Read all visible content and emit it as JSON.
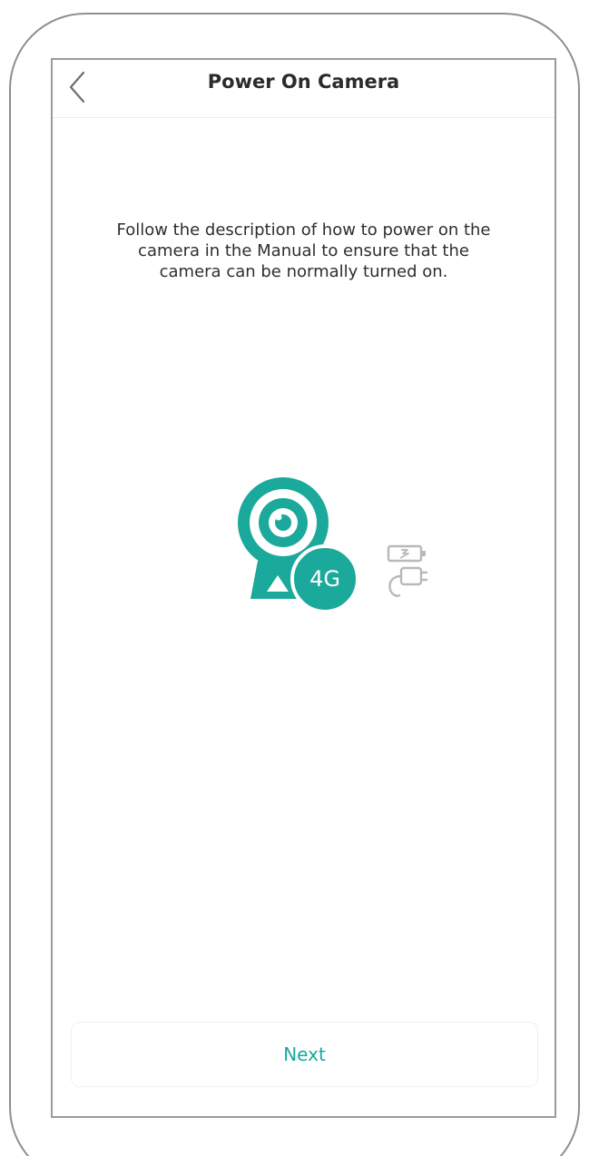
{
  "header": {
    "title": "Power On Camera"
  },
  "main": {
    "description": "Follow the description of how to power on the camera in the Manual to ensure that the camera can be normally turned on.",
    "badge_label": "4G"
  },
  "footer": {
    "next_label": "Next"
  },
  "icons": {
    "back": "chevron-left-icon",
    "camera": "camera-icon",
    "battery": "battery-icon",
    "plug": "power-plug-icon"
  },
  "colors": {
    "accent": "#1aa99a",
    "next_text": "#18a99b",
    "icon_gray": "#b9b9b9"
  }
}
